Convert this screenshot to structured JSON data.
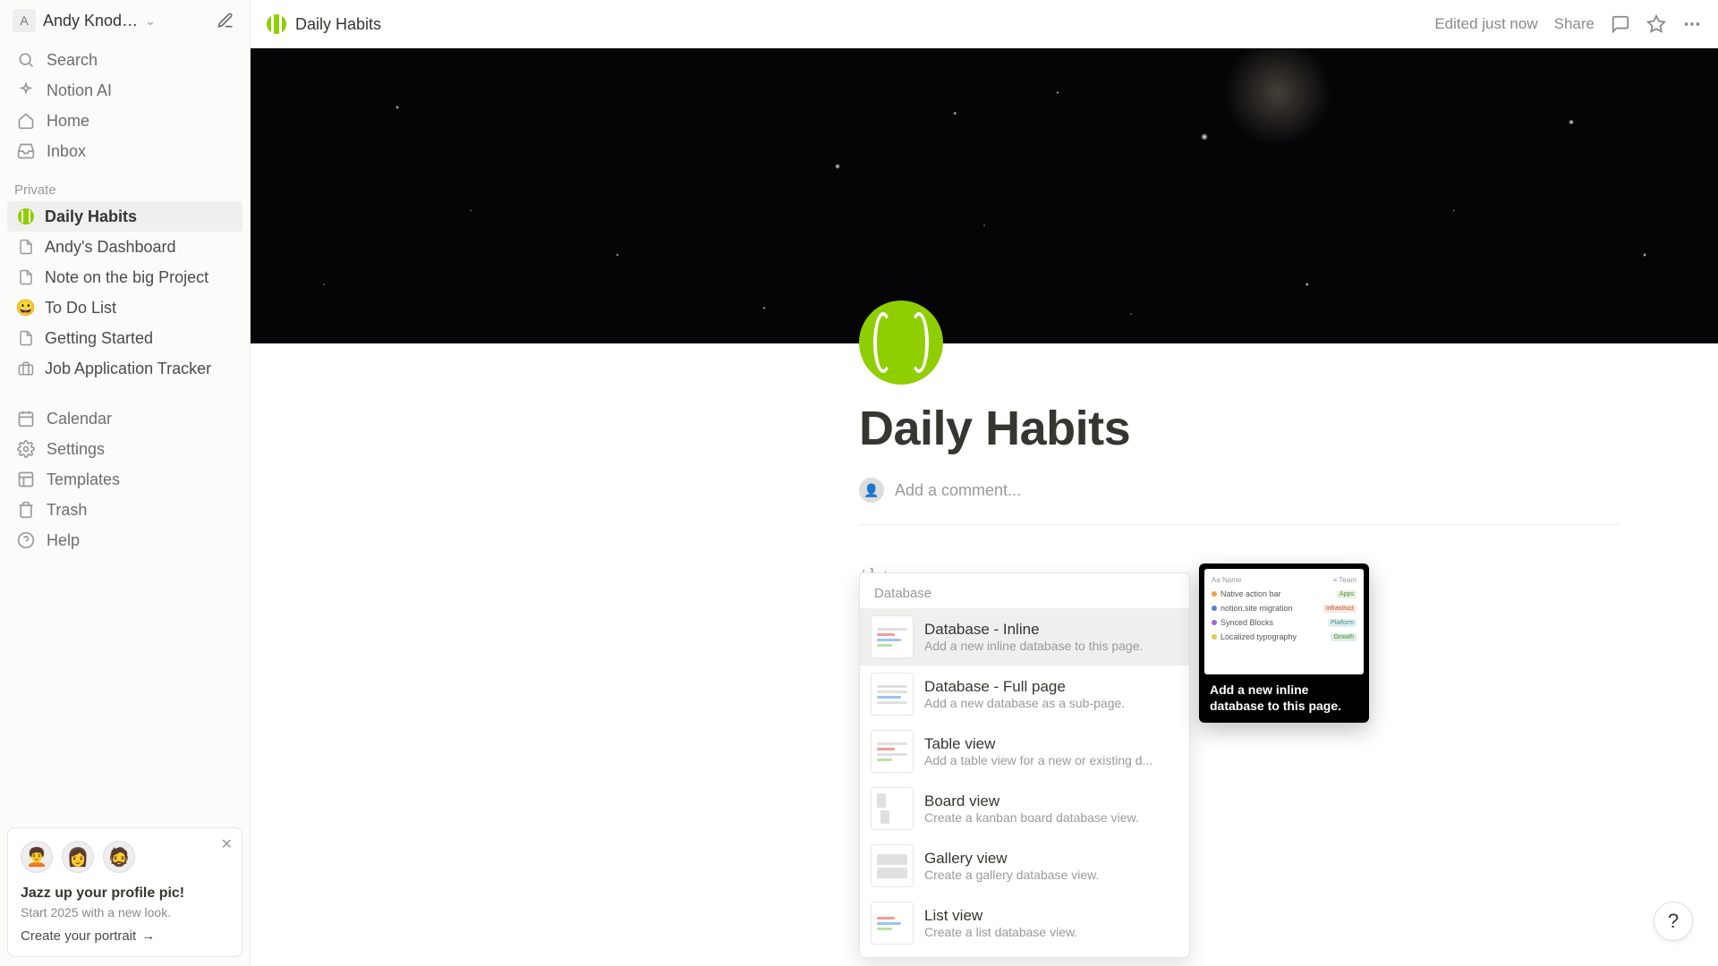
{
  "workspace": {
    "name": "Andy Knod…",
    "initial": "A"
  },
  "nav": {
    "search": "Search",
    "ai": "Notion AI",
    "home": "Home",
    "inbox": "Inbox"
  },
  "private_label": "Private",
  "pages": [
    {
      "icon": "tennis",
      "label": "Daily Habits",
      "active": true
    },
    {
      "icon": "doc",
      "label": "Andy's Dashboard"
    },
    {
      "icon": "doc",
      "label": "Note on the big Project"
    },
    {
      "icon": "emoji-smile",
      "label": "To Do List"
    },
    {
      "icon": "doc",
      "label": "Getting Started"
    },
    {
      "icon": "briefcase",
      "label": "Job Application Tracker"
    }
  ],
  "bottom": {
    "calendar": "Calendar",
    "settings": "Settings",
    "templates": "Templates",
    "trash": "Trash",
    "help": "Help"
  },
  "promo": {
    "title": "Jazz up your profile pic!",
    "sub": "Start 2025 with a new look.",
    "cta": "Create your portrait"
  },
  "breadcrumb": {
    "title": "Daily Habits"
  },
  "topbar": {
    "edited": "Edited just now",
    "share": "Share"
  },
  "page": {
    "title": "Daily Habits",
    "comment_placeholder": "Add a comment...",
    "slash_text": "/dat"
  },
  "slash_menu": {
    "section": "Database",
    "items": [
      {
        "title": "Database - Inline",
        "desc": "Add a new inline database to this page.",
        "highlight": true
      },
      {
        "title": "Database - Full page",
        "desc": "Add a new database as a sub-page."
      },
      {
        "title": "Table view",
        "desc": "Add a table view for a new or existing d..."
      },
      {
        "title": "Board view",
        "desc": "Create a kanban board database view."
      },
      {
        "title": "Gallery view",
        "desc": "Create a gallery database view."
      },
      {
        "title": "List view",
        "desc": "Create a list database view."
      }
    ]
  },
  "preview": {
    "caption": "Add a new inline database to this page.",
    "rows": [
      {
        "dot": "#f2a23c",
        "label": "Native action bar",
        "tag": "Apps",
        "tagbg": "#e8f0e0",
        "tagc": "#5a8a3a"
      },
      {
        "dot": "#5b7fd8",
        "label": "notion.site migration",
        "tag": "Infrastruct",
        "tagbg": "#fde8e0",
        "tagc": "#b05030"
      },
      {
        "dot": "#9b6bd8",
        "label": "Synced Blocks",
        "tag": "Platform",
        "tagbg": "#e0f0ef",
        "tagc": "#3a8a82"
      },
      {
        "dot": "#e8c850",
        "label": "Localized typography",
        "tag": "Growth",
        "tagbg": "#e0efe0",
        "tagc": "#3a8a3a"
      }
    ],
    "header_left": "Aa Name",
    "header_right": "≡ Team"
  }
}
